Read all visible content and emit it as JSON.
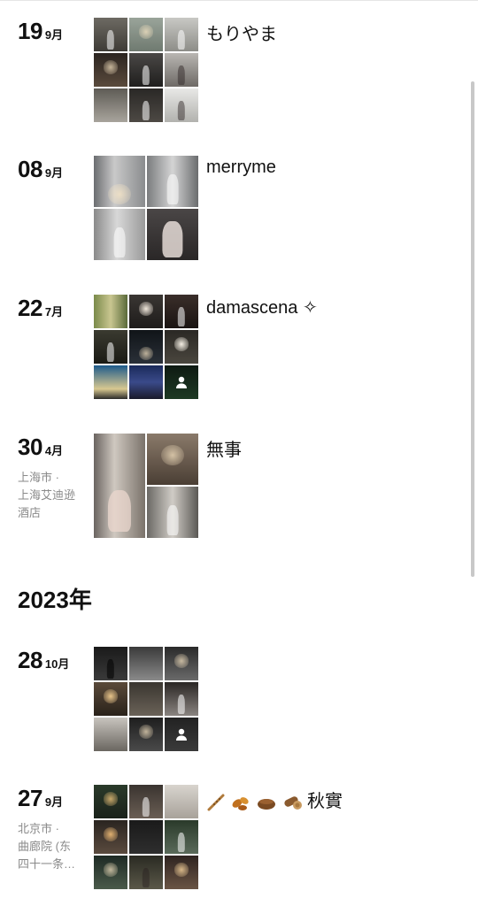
{
  "entries": [
    {
      "day": "19",
      "month": "9月",
      "caption": "もりやま",
      "location": []
    },
    {
      "day": "08",
      "month": "9月",
      "caption": "merryme",
      "location": []
    },
    {
      "day": "22",
      "month": "7月",
      "caption": "damascena ✧",
      "location": []
    },
    {
      "day": "30",
      "month": "4月",
      "caption": "無事",
      "location": [
        "上海市 ·",
        "上海艾迪逊",
        "酒店"
      ]
    },
    {
      "day": "28",
      "month": "10月",
      "caption": "",
      "location": []
    },
    {
      "day": "27",
      "month": "9月",
      "caption": "秋實",
      "location": [
        "北京市 ·",
        "曲廊院 (东",
        "四十一条…"
      ]
    }
  ],
  "year_header": "2023年",
  "colors": {
    "text": "#111111",
    "muted": "#8a8a8a",
    "scrollbar": "#c8c8c8"
  }
}
